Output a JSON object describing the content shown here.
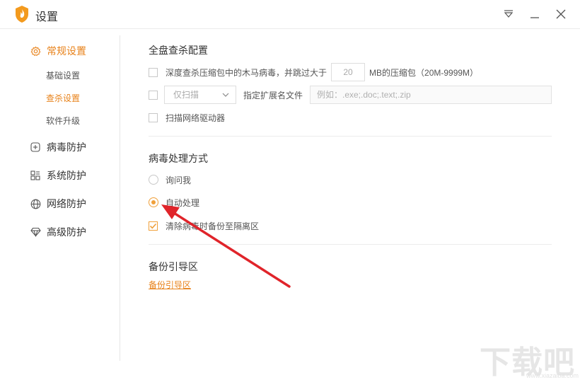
{
  "window": {
    "title": "设置"
  },
  "sidebar": {
    "groups": [
      {
        "label": "常规设置",
        "icon": "gear-icon",
        "active": true
      },
      {
        "label": "病毒防护",
        "icon": "plus-square-icon",
        "active": false
      },
      {
        "label": "系统防护",
        "icon": "grid-icon",
        "active": false
      },
      {
        "label": "网络防护",
        "icon": "globe-icon",
        "active": false
      },
      {
        "label": "高级防护",
        "icon": "diamond-icon",
        "active": false
      }
    ],
    "sub_items": [
      {
        "label": "基础设置",
        "active": false
      },
      {
        "label": "查杀设置",
        "active": true
      },
      {
        "label": "软件升级",
        "active": false
      }
    ]
  },
  "scan_config": {
    "title": "全盘查杀配置",
    "compressed_text_before": "深度查杀压缩包中的木马病毒，并跳过大于",
    "compressed_size": "20",
    "compressed_text_after": "MB的压缩包（20M-9999M）",
    "mode_select": "仅扫描",
    "ext_label": "指定扩展名文件",
    "ext_placeholder": "例如：.exe;.doc;.text;.zip",
    "network_drive_label": "扫描网络驱动器"
  },
  "virus_handling": {
    "title": "病毒处理方式",
    "options": [
      {
        "label": "询问我",
        "selected": false
      },
      {
        "label": "自动处理",
        "selected": true
      }
    ],
    "backup_label": "清除病毒时备份至隔离区",
    "backup_checked": true
  },
  "backup_boot": {
    "title": "备份引导区",
    "link": "备份引导区"
  },
  "watermark": {
    "text": "下载吧",
    "url": "www.xiazaiba.com"
  },
  "colors": {
    "accent": "#e8821a",
    "annotation_arrow": "#e0242a"
  }
}
